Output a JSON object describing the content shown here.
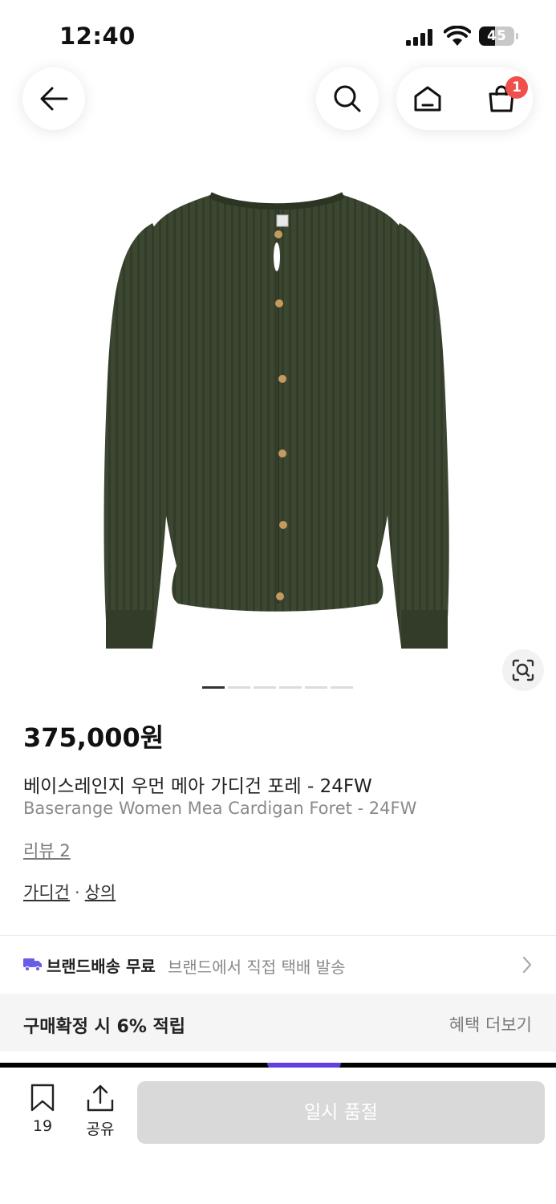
{
  "status_bar": {
    "time": "12:40",
    "battery": "45",
    "battery_level": 0.45,
    "icons": [
      "signal-icon",
      "wifi-icon",
      "battery-icon"
    ]
  },
  "nav": {
    "icons": [
      "arrow-left-icon",
      "search-icon",
      "home-icon",
      "cart-icon"
    ],
    "cart_badge": "1"
  },
  "product": {
    "image_count": 6,
    "active_image": 1,
    "price": "375,000원",
    "name_ko": "베이스레인지 우먼 메아 가디건 포레 - 24FW",
    "name_en": "Baserange Women Mea Cardigan Foret - 24FW",
    "reviews": "리뷰 2",
    "categories": [
      "가디건",
      "상의"
    ],
    "category_separator": "·"
  },
  "shipping": {
    "title": "브랜드배송 무료",
    "description": "브랜드에서 직접 택배 발송"
  },
  "points": {
    "text": "구매확정 시 6% 적립",
    "benefit_link": "혜택 더보기"
  },
  "bottom_bar": {
    "bookmark_count": "19",
    "share_label": "공유",
    "cta_label": "일시 품절"
  },
  "colors": {
    "accent_badge": "#f0504d",
    "truck": "#6b5ce7",
    "cardigan": "#3c4732",
    "disabled_button": "#d9d9d9"
  }
}
